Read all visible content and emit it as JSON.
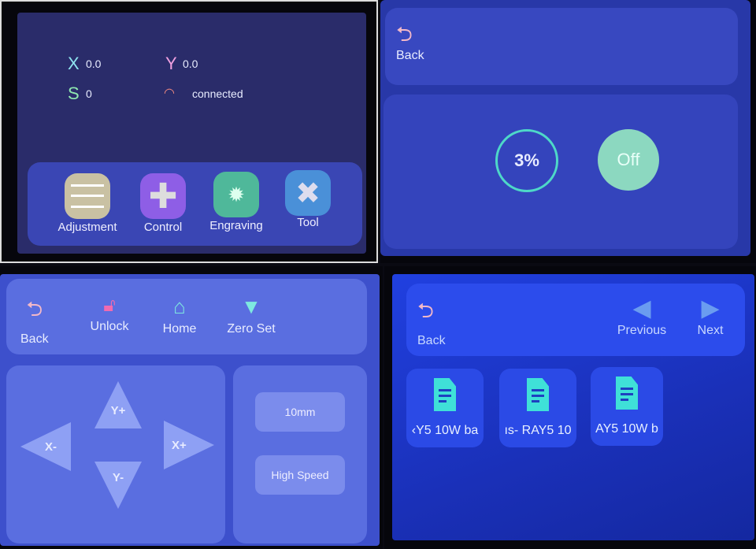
{
  "home": {
    "x_label": "X",
    "x_value": "0.0",
    "y_label": "Y",
    "y_value": "0.0",
    "s_label": "S",
    "s_value": "0",
    "wifi_icon": "wifi-icon",
    "status": "connected",
    "dock": [
      {
        "label": "Adjustment",
        "icon": "sliders-icon",
        "color": "#c9c1a3"
      },
      {
        "label": "Control",
        "icon": "dpad-icon",
        "color": "#8e5ee6"
      },
      {
        "label": "Engraving",
        "icon": "laser-icon",
        "color": "#4fb89a"
      },
      {
        "label": "Tool",
        "icon": "wrench-icon",
        "color": "#4a90d8"
      }
    ]
  },
  "power": {
    "back_label": "Back",
    "percent": "3%",
    "toggle": "Off"
  },
  "control": {
    "back_label": "Back",
    "unlock_label": "Unlock",
    "home_label": "Home",
    "zero_label": "Zero Set",
    "y_plus": "Y+",
    "y_minus": "Y-",
    "x_plus": "X+",
    "x_minus": "X-",
    "step": "10mm",
    "speed": "High Speed"
  },
  "files": {
    "back_label": "Back",
    "prev_label": "Previous",
    "next_label": "Next",
    "items": [
      "‹Y5 10W ba",
      "ıs- RAY5 10",
      "AY5 10W b"
    ]
  },
  "colors": {
    "back_icon": "#f2b8c8",
    "accent_cyan": "#3fe0d8",
    "unlock_icon": "#f06ab0"
  }
}
